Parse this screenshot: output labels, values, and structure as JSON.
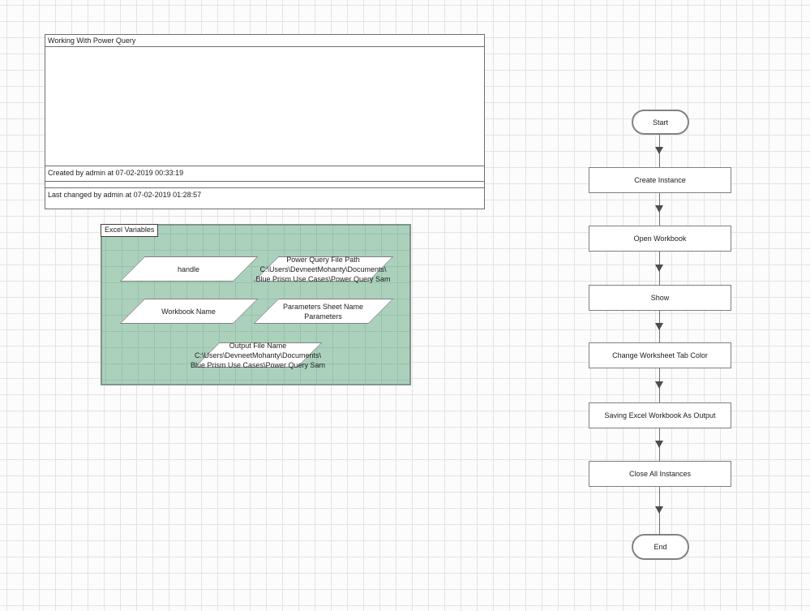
{
  "process_info": {
    "title": "Working With Power Query",
    "description": "",
    "created": "Created by admin at 07-02-2019 00:33:19",
    "last_changed": "Last changed by admin at 07-02-2019 01:28:57"
  },
  "variables_group": {
    "label": "Excel Variables",
    "items": [
      {
        "name": "handle",
        "text": "handle"
      },
      {
        "name": "power-query-file-path",
        "text": "Power Query File Path\nC:\\Users\\DevneetMohanty\\Documents\\\nBlue Prism Use Cases\\Power Query Sam"
      },
      {
        "name": "workbook-name",
        "text": "Workbook Name"
      },
      {
        "name": "parameters-sheet-name",
        "text": "Parameters Sheet Name\nParameters"
      },
      {
        "name": "output-file-name",
        "text": "Output File Name\nC:\\Users\\DevneetMohanty\\Documents\\\nBlue Prism Use Cases\\Power Query Sam"
      }
    ]
  },
  "flow": {
    "nodes": [
      {
        "type": "terminal",
        "label": "Start"
      },
      {
        "type": "action",
        "label": "Create Instance"
      },
      {
        "type": "action",
        "label": "Open Workbook"
      },
      {
        "type": "action",
        "label": "Show"
      },
      {
        "type": "action",
        "label": "Change Worksheet Tab Color"
      },
      {
        "type": "action",
        "label": "Saving Excel Workbook As Output"
      },
      {
        "type": "action",
        "label": "Close All Instances"
      },
      {
        "type": "terminal",
        "label": "End"
      }
    ]
  },
  "colors": {
    "group_fill": "#abd1bc",
    "group_border": "#7e968b",
    "shape_border": "#7f7f7f",
    "grid_line": "#e3e3e3",
    "arrow": "#4d4d4d"
  }
}
